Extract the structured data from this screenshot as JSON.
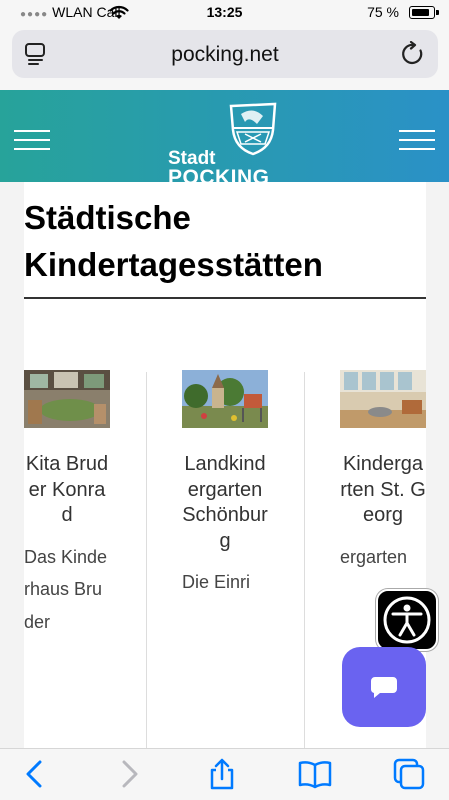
{
  "status_bar": {
    "carrier": "WLAN Call",
    "time": "13:25",
    "battery": "75 %"
  },
  "browser": {
    "url": "pocking.net"
  },
  "site": {
    "logo_line1": "Stadt",
    "logo_line2": "POCKING"
  },
  "page": {
    "title": "Städtische Kindertagesstätten",
    "facilities": [
      {
        "name": "Kita Bruder Konrad",
        "description": "Das Kinderhaus Bruder"
      },
      {
        "name": "Landkindergarten Schönburg",
        "description": "Die Einri"
      },
      {
        "name": "Kindergarten St. Georg",
        "description": "ergarten"
      }
    ]
  },
  "colors": {
    "header_gradient_start": "#27a39a",
    "header_gradient_end": "#2a91c7",
    "chat_button": "#6a63f0",
    "browser_accent": "#007aff"
  }
}
